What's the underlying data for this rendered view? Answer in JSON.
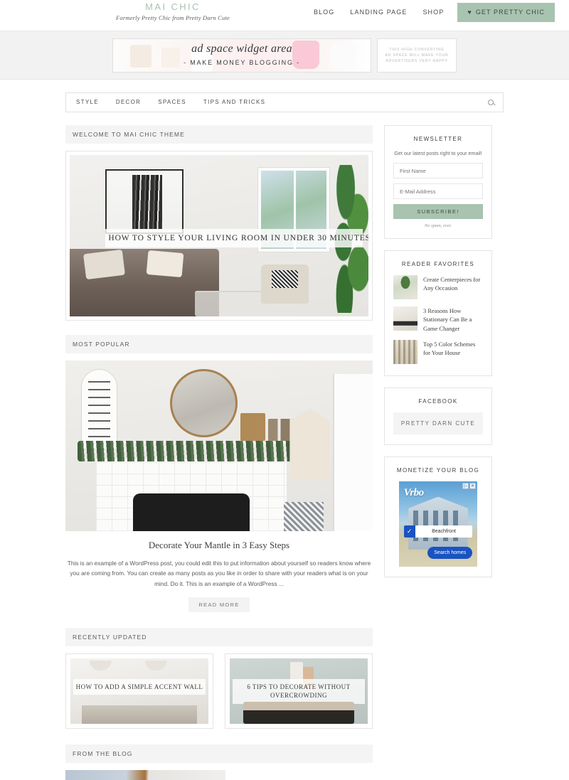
{
  "header": {
    "site_title": "MAI CHIC",
    "tagline": "Formerly Pretty Chic from Pretty Darn Cute",
    "nav": [
      {
        "label": "BLOG"
      },
      {
        "label": "LANDING PAGE"
      },
      {
        "label": "SHOP"
      }
    ],
    "cta": {
      "icon": "heart-icon",
      "glyph": "♥",
      "label": "GET PRETTY CHIC",
      "bg": "#a8c3b0"
    }
  },
  "ad_bar": {
    "wide_ad": {
      "script_text": "ad space widget area",
      "sub_text": "- MAKE MONEY BLOGGING -"
    },
    "small_ad": {
      "line1": "THIS HIGH CONVERTING",
      "line2": "AD SPACE WILL MAKE YOUR",
      "line3": "ADVERTISERS VERY HAPPY"
    }
  },
  "nav_bar": {
    "items": [
      {
        "label": "STYLE"
      },
      {
        "label": "DECOR"
      },
      {
        "label": "SPACES"
      },
      {
        "label": "TIPS AND TRICKS"
      }
    ],
    "search_icon": "search-icon"
  },
  "main": {
    "welcome": {
      "heading": "WELCOME TO MAI CHIC THEME",
      "hero_title": "HOW TO STYLE YOUR LIVING ROOM IN UNDER 30 MINUTES"
    },
    "most_popular": {
      "heading": "MOST POPULAR",
      "post_title": "Decorate Your Mantle in 3 Easy Steps",
      "excerpt": "This is an example of a WordPress post, you could edit this to put information about yourself so readers know where you are coming from. You can create as many posts as you like in order to share with your readers what is on your mind. Do it. This is an example of a WordPress ...",
      "read_more": "READ MORE"
    },
    "recently_updated": {
      "heading": "RECENTLY UPDATED",
      "cards": [
        {
          "title": "HOW TO ADD A SIMPLE ACCENT WALL"
        },
        {
          "title": "6 TIPS TO DECORATE WITHOUT OVERCROWDING"
        }
      ]
    },
    "from_the_blog": {
      "heading": "FROM THE BLOG"
    }
  },
  "sidebar": {
    "newsletter": {
      "title": "NEWSLETTER",
      "subtitle": "Get our latest posts right to your email!",
      "first_name_placeholder": "First Name",
      "email_placeholder": "E-Mail Address",
      "button_label": "SUBSCRIBE!",
      "note": "No spam, ever.",
      "button_bg": "#a8c3b0"
    },
    "reader_favorites": {
      "title": "READER FAVORITES",
      "items": [
        {
          "title": "Create Centerpieces for Any Occasion"
        },
        {
          "title": "3 Reasons How Stationary Can Be a Game Changer"
        },
        {
          "title": "Top 5 Color Schemes for Your House"
        }
      ]
    },
    "facebook": {
      "title": "FACEBOOK",
      "page_name": "PRETTY DARN CUTE"
    },
    "monetize": {
      "title": "MONETIZE YOUR BLOG",
      "ad": {
        "brand": "Vrbo",
        "field_label": "Beachfront",
        "cta_label": "Search homes",
        "adchoices": "▷",
        "close": "✕",
        "check": "✓"
      }
    }
  }
}
